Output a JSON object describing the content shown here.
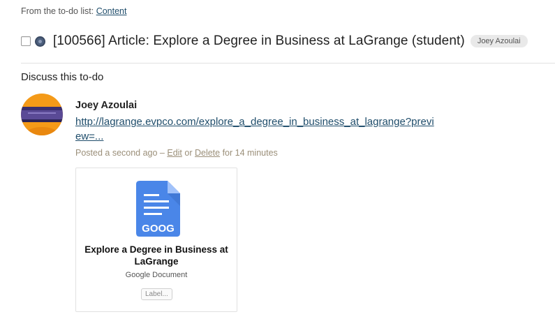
{
  "breadcrumb": {
    "prefix": "From the to-do list: ",
    "list_name": "Content"
  },
  "todo": {
    "title": "[100566] Article: Explore a Degree in Business at LaGrange (student)",
    "assignee": "Joey Azoulai",
    "completed": false
  },
  "discussion": {
    "heading": "Discuss this to-do"
  },
  "comment": {
    "author": "Joey Azoulai",
    "link_text": "http://lagrange.evpco.com/explore_a_degree_in_business_at_lagrange?preview=...",
    "posted": "Posted a second ago – ",
    "edit_label": "Edit",
    "or_text": " or ",
    "delete_label": "Delete",
    "edit_window": " for 14 minutes"
  },
  "attachment": {
    "icon_text": "GOOG",
    "title": "Explore a Degree in Business at LaGrange",
    "type": "Google Document",
    "label_button": "Label..."
  },
  "colors": {
    "link": "#1f4d6b",
    "meta": "#9b8f79",
    "avatar_bg": "#f49a18",
    "doc_blue": "#4a86e8"
  }
}
